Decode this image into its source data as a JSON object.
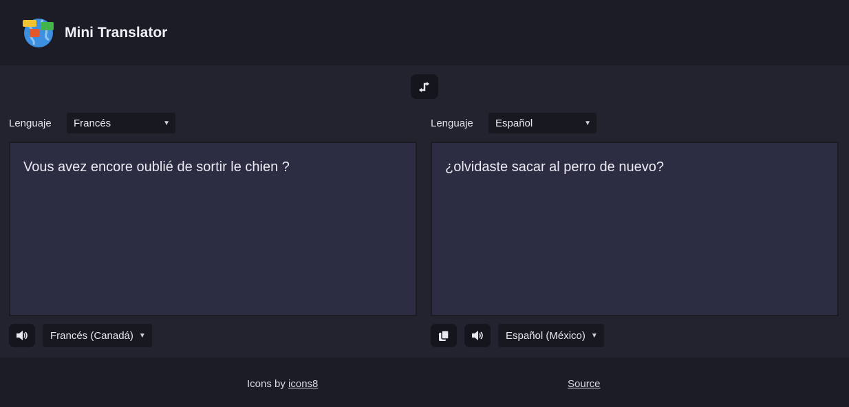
{
  "app": {
    "title": "Mini Translator"
  },
  "swap": {
    "icon": "swap-arrows-icon"
  },
  "source": {
    "lang_label": "Lenguaje",
    "language": "Francés",
    "text": "Vous avez encore oublié de sortir le chien ?",
    "voice": "Francés (Canadá)"
  },
  "target": {
    "lang_label": "Lenguaje",
    "language": "Español",
    "text": "¿olvidaste sacar al perro de nuevo?",
    "voice": "Español (México)"
  },
  "footer": {
    "credit_prefix": "Icons by ",
    "credit_link": "icons8",
    "source_link": "Source"
  },
  "colors": {
    "page_bg": "#1b1c25",
    "panel_bg": "#22232e",
    "textarea_bg": "#2c2d42",
    "button_bg": "#15161d"
  }
}
